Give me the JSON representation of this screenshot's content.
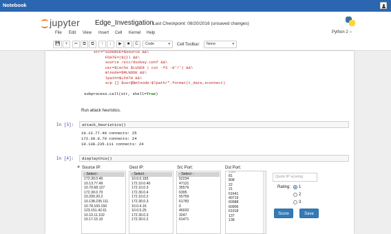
{
  "os": {
    "app_title": "Notebook"
  },
  "header": {
    "logo_text": "jupyter",
    "notebook_name": "Edge_Investigation",
    "checkpoint": "Last Checkpoint: 08/20/2016 (unsaved changes)",
    "kernel": "Python 2"
  },
  "menu": [
    "File",
    "Edit",
    "View",
    "Insert",
    "Cell",
    "Kernel",
    "Help"
  ],
  "toolbar": {
    "buttons": [
      "💾",
      "+",
      "✂",
      "⧉",
      "⧉",
      "↑",
      "↓",
      "▶",
      "■",
      "C"
    ],
    "cell_type": "Code",
    "cell_toolbar_label": "Cell Toolbar:",
    "cell_toolbar_value": "None"
  },
  "cell_top": {
    "red_lines": [
      "str=\"SSOURCE=$source &&\\",
      "     FDATE=(${}) &&\\",
      "     source /etc/duxbay.conf &&\\",
      "     usr=$(echo $LUSER | cut -f3 -d'/') &&\\",
      "     mlnode=$MLNODE &&\\",
      "     lpath=$LPATH &&\\",
      "     scp {} $usr@$mlnode:$lpath/\".format(t_date,sconnect)"
    ],
    "last_line_a": "subprocess.call(str, shell=",
    "last_line_kw": "True",
    "last_line_b": ")"
  },
  "markdown": {
    "text": "Run attack heuristics."
  },
  "cell3": {
    "prompt": "In [3]:",
    "code": "attack_heuristics()",
    "output": [
      "10.13.77.49 connects: 25",
      "172.30.0.70 connects: 24",
      "10.138.235.111 connects: 24"
    ]
  },
  "cell4": {
    "prompt": "In [4]:",
    "code": "displaythis()"
  },
  "widget": {
    "source_ip": {
      "label": "Source IP:",
      "selected": "- Select -",
      "items": [
        "172.30.0.46",
        "10.13.77.49",
        "10.70.68.127",
        "172.30.0.70",
        "10.200.20.2",
        "10.138.235.111",
        "10.78.100.150",
        "123.151.42.61",
        "10.10.11.102",
        "10.17.15.10"
      ]
    },
    "dest_ip": {
      "label": "Dest IP:",
      "selected": "- Select -",
      "items": [
        "10.0.0.183",
        "172.10.0.40",
        "172.10.0.3",
        "172.30.0.4",
        "172.10.0.2",
        "172.30.0.3",
        "10.0.4.16",
        "10.0.5.25",
        "172.30.0.3",
        "172.30.0.2"
      ]
    },
    "src_port": {
      "label": "Src Port:",
      "selected": "- Select -",
      "items": [
        "52234",
        "47131",
        "35579",
        "6395",
        "55759",
        "61783",
        "0",
        "46032",
        "3247",
        "61471"
      ]
    },
    "dst_port": {
      "label": "Dst Port:",
      "items": [
        "3389",
        "81",
        "808",
        "22",
        "21",
        "61641",
        "40719",
        "60988",
        "60906",
        "61918",
        "137",
        "138"
      ]
    },
    "quick_ip_placeholder": "Quick IP scoring",
    "rating_label": "Rating:",
    "rating_options": [
      "1",
      "2",
      "3"
    ],
    "score_button": "Score",
    "save_button": "Save"
  }
}
